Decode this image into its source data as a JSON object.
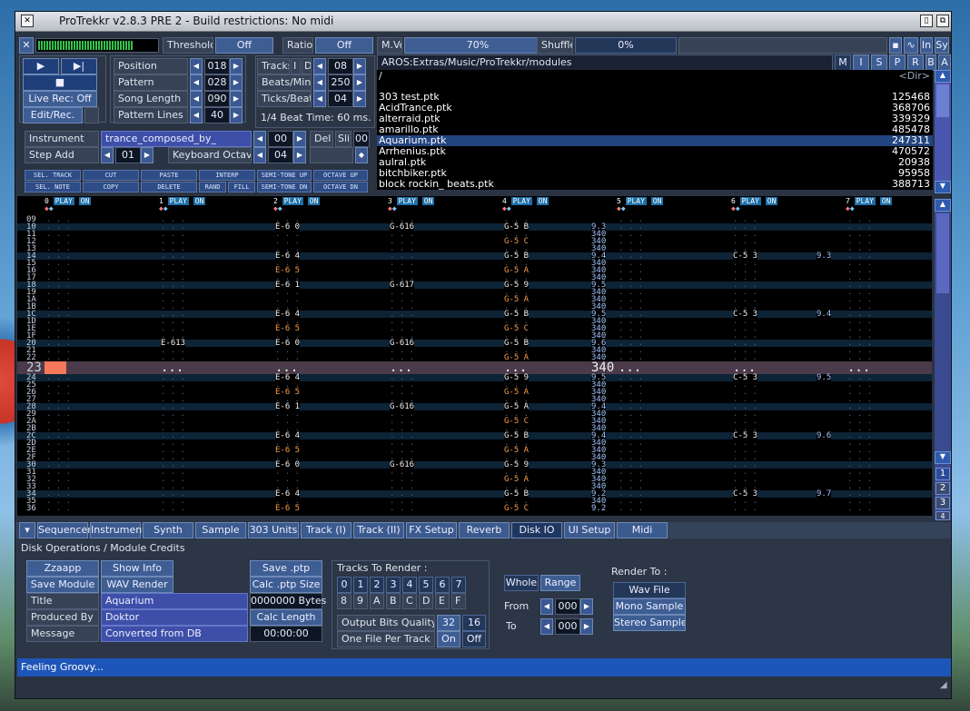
{
  "window": {
    "title": "ProTrekkr v2.8.3 PRE 2 - Build restrictions: No midi"
  },
  "top": {
    "threshold_label": "Threshold",
    "threshold_val": "Off",
    "ratio_label": "Ratio",
    "ratio_val": "Off",
    "mvol_label": "M.Vol",
    "mvol_val": "70%",
    "shuffle_label": "Shuffle",
    "shuffle_val": "0%",
    "right_btns": [
      "In",
      "Sy"
    ]
  },
  "transport": {
    "live_rec": "Live Rec: Off",
    "edit_rec": "Edit/Rec."
  },
  "song": [
    {
      "label": "Position",
      "value": "018"
    },
    {
      "label": "Pattern",
      "value": "028"
    },
    {
      "label": "Song Length",
      "value": "090"
    },
    {
      "label": "Pattern Lines",
      "value": "40"
    }
  ],
  "tracks": {
    "label": "Tracks",
    "opt_i": "I",
    "opt_d": "D",
    "value": "08",
    "bpm_label": "Beats/Min.",
    "bpm": "250",
    "tpb_label": "Ticks/Beat",
    "tpb": "04",
    "beat_time": "1/4 Beat Time: 60 ms."
  },
  "instrument": {
    "label": "Instrument",
    "name": "trance_composed_by_",
    "num": "00",
    "del": "Del",
    "sli": "Sli",
    "sli_val": "00",
    "step_label": "Step Add",
    "step": "01",
    "oct_label": "Keyboard Octave",
    "oct": "04"
  },
  "edit_btns": [
    "SEL. TRACK",
    "CUT",
    "PASTE",
    "INTERP",
    "SEMI-TONE UP",
    "OCTAVE UP",
    "SEL. NOTE",
    "COPY",
    "DELETE",
    "RAND",
    "FILL",
    "SEMI-TONE DN",
    "OCTAVE DN"
  ],
  "files": {
    "path": "AROS:Extras/Music/ProTrekkr/modules",
    "path_btns": [
      "M",
      "I",
      "S",
      "P",
      "R",
      "B",
      "A"
    ],
    "root": "/",
    "dir_tag": "<Dir>",
    "list": [
      {
        "name": "303 test.ptk",
        "size": "125468"
      },
      {
        "name": "AcidTrance.ptk",
        "size": "368706"
      },
      {
        "name": "alterraid.ptk",
        "size": "339329"
      },
      {
        "name": "amarillo.ptk",
        "size": "485478"
      },
      {
        "name": "Aquarium.ptk",
        "size": "247311"
      },
      {
        "name": "Arrhenius.ptk",
        "size": "470572"
      },
      {
        "name": "aulral.ptk",
        "size": "20938"
      },
      {
        "name": "bitchbiker.ptk",
        "size": "95958"
      },
      {
        "name": "block rockin_ beats.ptk",
        "size": "388713"
      }
    ]
  },
  "pattern": {
    "channels": [
      "0",
      "1",
      "2",
      "3",
      "4",
      "5",
      "6",
      "7"
    ],
    "play": "PLAY",
    "on": "ON",
    "rows": [
      {
        "n": "09",
        "c": []
      },
      {
        "n": "10",
        "c": [
          [
            2,
            "E-6 0",
            "ce"
          ],
          [
            3,
            "G-616",
            "ce"
          ],
          [
            4,
            "G-5 B",
            "ce"
          ],
          [
            5,
            "9.3",
            "cb"
          ]
        ]
      },
      {
        "n": "11",
        "c": [
          [
            5,
            "340",
            "cb"
          ]
        ]
      },
      {
        "n": "12",
        "c": [
          [
            4,
            "G-5 C",
            "co"
          ],
          [
            5,
            "340",
            "cb"
          ]
        ]
      },
      {
        "n": "13",
        "c": [
          [
            5,
            "340",
            "cb"
          ]
        ]
      },
      {
        "n": "14",
        "c": [
          [
            2,
            "E-6 4",
            "ce"
          ],
          [
            4,
            "G-5 B",
            "ce"
          ],
          [
            5,
            "9.4",
            "cb"
          ],
          [
            6,
            "C-5 3",
            "ce"
          ],
          [
            7,
            "9.3",
            "cb"
          ]
        ]
      },
      {
        "n": "15",
        "c": [
          [
            5,
            "340",
            "cb"
          ]
        ]
      },
      {
        "n": "16",
        "c": [
          [
            2,
            "E-6 5",
            "co"
          ],
          [
            4,
            "G-5 A",
            "co"
          ],
          [
            5,
            "340",
            "cb"
          ]
        ]
      },
      {
        "n": "17",
        "c": [
          [
            5,
            "340",
            "cb"
          ]
        ]
      },
      {
        "n": "18",
        "c": [
          [
            2,
            "E-6 1",
            "ce"
          ],
          [
            3,
            "G-617",
            "ce"
          ],
          [
            4,
            "G-5 9",
            "ce"
          ],
          [
            5,
            "9.5",
            "cb"
          ]
        ]
      },
      {
        "n": "19",
        "c": [
          [
            5,
            "340",
            "cb"
          ]
        ]
      },
      {
        "n": "1A",
        "c": [
          [
            4,
            "G-5 A",
            "co"
          ],
          [
            5,
            "340",
            "cb"
          ]
        ]
      },
      {
        "n": "1B",
        "c": [
          [
            5,
            "340",
            "cb"
          ]
        ]
      },
      {
        "n": "1C",
        "c": [
          [
            2,
            "E-6 4",
            "ce"
          ],
          [
            4,
            "G-5 B",
            "ce"
          ],
          [
            5,
            "9.5",
            "cb"
          ],
          [
            6,
            "C-5 3",
            "ce"
          ],
          [
            7,
            "9.4",
            "cb"
          ]
        ]
      },
      {
        "n": "1D",
        "c": [
          [
            5,
            "340",
            "cb"
          ]
        ]
      },
      {
        "n": "1E",
        "c": [
          [
            2,
            "E-6 5",
            "co"
          ],
          [
            4,
            "G-5 C",
            "co"
          ],
          [
            5,
            "340",
            "cb"
          ]
        ]
      },
      {
        "n": "1F",
        "c": [
          [
            5,
            "340",
            "cb"
          ]
        ]
      },
      {
        "n": "20",
        "c": [
          [
            1,
            "E-613",
            "ce"
          ],
          [
            2,
            "E-6 0",
            "ce"
          ],
          [
            3,
            "G-616",
            "ce"
          ],
          [
            4,
            "G-5 B",
            "ce"
          ],
          [
            5,
            "9.6",
            "cb"
          ]
        ]
      },
      {
        "n": "21",
        "c": [
          [
            5,
            "340",
            "cb"
          ]
        ]
      },
      {
        "n": "22",
        "c": [
          [
            4,
            "G-5 A",
            "co"
          ],
          [
            5,
            "340",
            "cb"
          ]
        ]
      },
      {
        "n": "23",
        "cur": true,
        "c": [
          [
            5,
            "340",
            "ce"
          ]
        ]
      },
      {
        "n": "24",
        "c": [
          [
            2,
            "E-6 4",
            "ce"
          ],
          [
            4,
            "G-5 9",
            "ce"
          ],
          [
            5,
            "9.5",
            "cb"
          ],
          [
            6,
            "C-5 3",
            "ce"
          ],
          [
            7,
            "9.5",
            "cb"
          ]
        ]
      },
      {
        "n": "25",
        "c": [
          [
            5,
            "340",
            "cb"
          ]
        ]
      },
      {
        "n": "26",
        "c": [
          [
            2,
            "E-6 5",
            "co"
          ],
          [
            4,
            "G-5 A",
            "co"
          ],
          [
            5,
            "340",
            "cb"
          ]
        ]
      },
      {
        "n": "27",
        "c": [
          [
            5,
            "340",
            "cb"
          ]
        ]
      },
      {
        "n": "28",
        "c": [
          [
            2,
            "E-6 1",
            "ce"
          ],
          [
            3,
            "G-616",
            "ce"
          ],
          [
            4,
            "G-5 A",
            "ce"
          ],
          [
            5,
            "9.4",
            "cb"
          ]
        ]
      },
      {
        "n": "29",
        "c": [
          [
            5,
            "340",
            "cb"
          ]
        ]
      },
      {
        "n": "2A",
        "c": [
          [
            4,
            "G-5 C",
            "co"
          ],
          [
            5,
            "340",
            "cb"
          ]
        ]
      },
      {
        "n": "2B",
        "c": [
          [
            5,
            "340",
            "cb"
          ]
        ]
      },
      {
        "n": "2C",
        "c": [
          [
            2,
            "E-6 4",
            "ce"
          ],
          [
            4,
            "G-5 B",
            "ce"
          ],
          [
            5,
            "9.4",
            "cb"
          ],
          [
            6,
            "C-5 3",
            "ce"
          ],
          [
            7,
            "9.6",
            "cb"
          ]
        ]
      },
      {
        "n": "2D",
        "c": [
          [
            5,
            "340",
            "cb"
          ]
        ]
      },
      {
        "n": "2E",
        "c": [
          [
            2,
            "E-6 5",
            "co"
          ],
          [
            4,
            "G-5 A",
            "co"
          ],
          [
            5,
            "340",
            "cb"
          ]
        ]
      },
      {
        "n": "2F",
        "c": [
          [
            5,
            "340",
            "cb"
          ]
        ]
      },
      {
        "n": "30",
        "c": [
          [
            2,
            "E-6 0",
            "ce"
          ],
          [
            3,
            "G-616",
            "ce"
          ],
          [
            4,
            "G-5 9",
            "ce"
          ],
          [
            5,
            "9.3",
            "cb"
          ]
        ]
      },
      {
        "n": "31",
        "c": [
          [
            5,
            "340",
            "cb"
          ]
        ]
      },
      {
        "n": "32",
        "c": [
          [
            4,
            "G-5 A",
            "co"
          ],
          [
            5,
            "340",
            "cb"
          ]
        ]
      },
      {
        "n": "33",
        "c": [
          [
            5,
            "340",
            "cb"
          ]
        ]
      },
      {
        "n": "34",
        "c": [
          [
            2,
            "E-6 4",
            "ce"
          ],
          [
            4,
            "G-5 B",
            "ce"
          ],
          [
            5,
            "9.2",
            "cb"
          ],
          [
            6,
            "C-5 3",
            "ce"
          ],
          [
            7,
            "9.7",
            "cb"
          ]
        ]
      },
      {
        "n": "35",
        "c": [
          [
            5,
            "340",
            "cb"
          ]
        ]
      },
      {
        "n": "36",
        "c": [
          [
            2,
            "E-6 5",
            "co"
          ],
          [
            4,
            "G-5 C",
            "co"
          ],
          [
            5,
            "9.2",
            "cb"
          ]
        ]
      }
    ]
  },
  "scroll_pages": [
    "1",
    "2",
    "3",
    "4"
  ],
  "tabs": [
    "Sequencer",
    "Instrument",
    "Synth",
    "Sample Ed.",
    "303 Units",
    "Track (I)",
    "Track (II)",
    "FX Setup",
    "Reverb",
    "Disk IO",
    "UI Setup",
    "Midi Setup"
  ],
  "active_tab": "Disk IO",
  "disk": {
    "section": "Disk Operations / Module Credits",
    "zzaapp": "Zzaapp",
    "show_info": "Show Info",
    "save_ptp": "Save .ptp",
    "save_module": "Save Module",
    "wav_render": "WAV Render",
    "calc_ptp": "Calc .ptp Size",
    "title_label": "Title",
    "title": "Aquarium",
    "bytes": "0000000 Bytes",
    "produced_label": "Produced By",
    "produced": "Doktor",
    "calc_length": "Calc Length",
    "message_label": "Message",
    "message": "Converted from DB",
    "time": "00:00:00"
  },
  "render": {
    "tracks_label": "Tracks To Render :",
    "tracks": [
      "0",
      "1",
      "2",
      "3",
      "4",
      "5",
      "6",
      "7",
      "8",
      "9",
      "A",
      "B",
      "C",
      "D",
      "E",
      "F"
    ],
    "bits_label": "Output Bits Quality",
    "bits": [
      "32",
      "16"
    ],
    "one_file_label": "One File Per Track",
    "one_file": [
      "On",
      "Off"
    ],
    "whole": "Whole",
    "range": "Range",
    "from_label": "From",
    "from": "000",
    "to_label": "To",
    "to": "000",
    "render_to": "Render To :",
    "targets": [
      "Wav File",
      "Mono Sample",
      "Stereo Sample"
    ]
  },
  "status": "Feeling Groovy...",
  "colors": {
    "accent": "#3e5e93",
    "selection": "#23457f",
    "status": "#1e55b8"
  }
}
